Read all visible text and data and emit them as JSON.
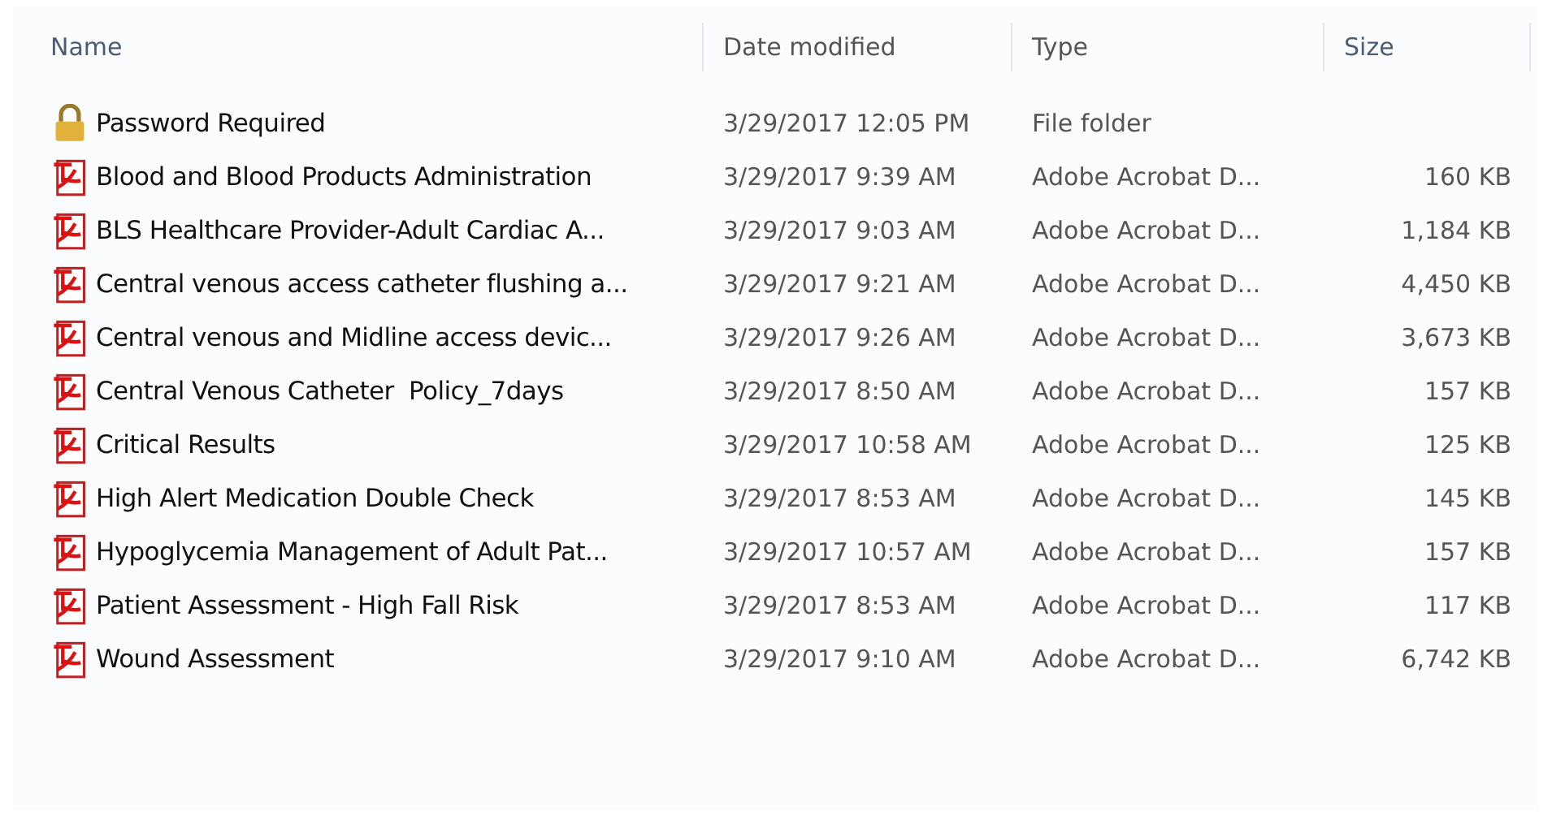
{
  "table": {
    "columns": [
      "Name",
      "Date modified",
      "Type",
      "Size"
    ],
    "rows": [
      {
        "kind": "folder",
        "name": "Password Required",
        "date": "3/29/2017 12:05 PM",
        "type": "File folder"
      },
      {
        "kind": "pdf",
        "name": "Blood and Blood Products Administration",
        "date": "3/29/2017 9:39 AM",
        "type": "Adobe Acrobat D...",
        "size": "160 KB"
      },
      {
        "kind": "pdf",
        "name": "BLS Healthcare Provider-Adult Cardiac A...",
        "date": "3/29/2017 9:03 AM",
        "type": "Adobe Acrobat D...",
        "size": "1,184 KB"
      },
      {
        "kind": "pdf",
        "name": "Central venous access catheter flushing a...",
        "date": "3/29/2017 9:21 AM",
        "type": "Adobe Acrobat D...",
        "size": "4,450 KB"
      },
      {
        "kind": "pdf",
        "name": "Central venous and Midline access devic...",
        "date": "3/29/2017 9:26 AM",
        "type": "Adobe Acrobat D...",
        "size": "3,673 KB"
      },
      {
        "kind": "pdf",
        "name": "Central Venous Catheter  Policy_7days",
        "date": "3/29/2017 8:50 AM",
        "type": "Adobe Acrobat D...",
        "size": "157 KB"
      },
      {
        "kind": "pdf",
        "name": "Critical Results",
        "date": "3/29/2017 10:58 AM",
        "type": "Adobe Acrobat D...",
        "size": "125 KB"
      },
      {
        "kind": "pdf",
        "name": "High Alert Medication Double Check",
        "date": "3/29/2017 8:53 AM",
        "type": "Adobe Acrobat D...",
        "size": "145 KB"
      },
      {
        "kind": "pdf",
        "name": "Hypoglycemia Management of Adult Pat...",
        "date": "3/29/2017 10:57 AM",
        "type": "Adobe Acrobat D...",
        "size": "157 KB"
      },
      {
        "kind": "pdf",
        "name": "Patient Assessment - High Fall Risk",
        "date": "3/29/2017 8:53 AM",
        "type": "Adobe Acrobat D...",
        "size": "117 KB"
      },
      {
        "kind": "pdf",
        "name": "Wound Assessment",
        "date": "3/29/2017 9:10 AM",
        "type": "Adobe Acrobat D...",
        "size": "6,742 KB"
      }
    ]
  }
}
